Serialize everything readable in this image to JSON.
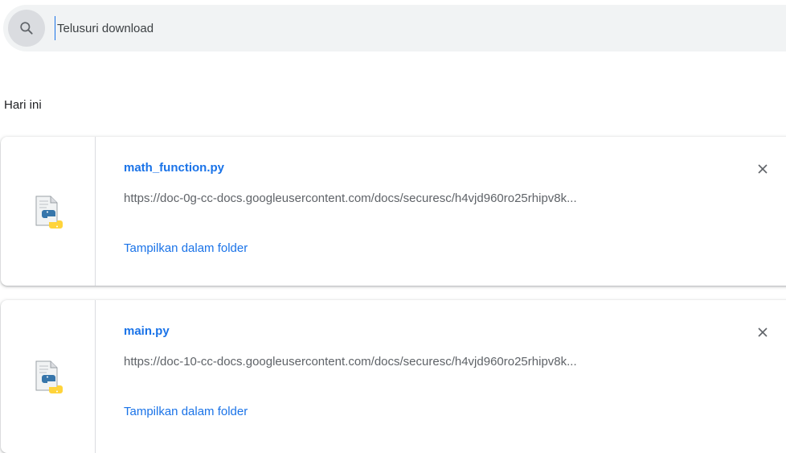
{
  "search": {
    "placeholder": "Telusuri download",
    "value": ""
  },
  "sections": [
    {
      "title": "Hari ini",
      "downloads": [
        {
          "file_name": "math_function.py",
          "url": "https://doc-0g-cc-docs.googleusercontent.com/docs/securesc/h4vjd960ro25rhipv8k...",
          "action_label": "Tampilkan dalam folder",
          "file_icon": "python-file-icon",
          "remove_icon": "close-icon"
        },
        {
          "file_name": "main.py",
          "url": "https://doc-10-cc-docs.googleusercontent.com/docs/securesc/h4vjd960ro25rhipv8k...",
          "action_label": "Tampilkan dalam folder",
          "file_icon": "python-file-icon",
          "remove_icon": "close-icon"
        }
      ]
    }
  ],
  "colors": {
    "link": "#1a73e8",
    "muted_text": "#5f6368",
    "search_background": "#f1f3f4",
    "search_icon_background": "#dadce0"
  }
}
